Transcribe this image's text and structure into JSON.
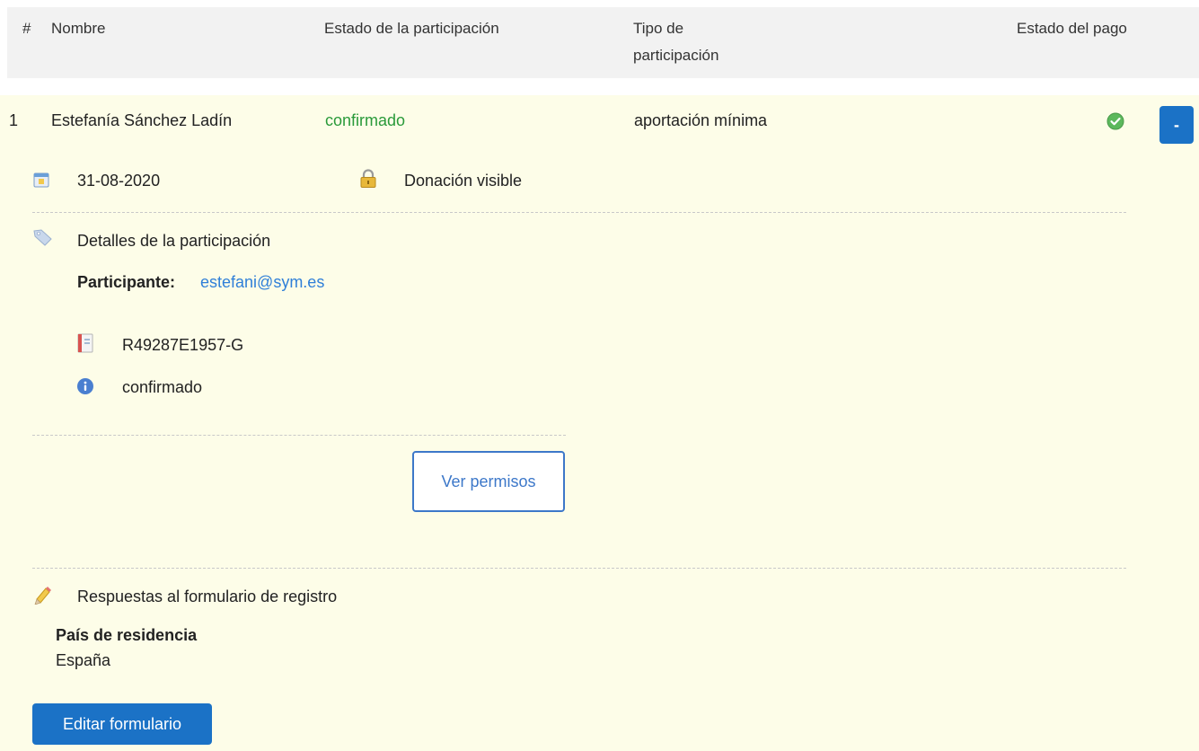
{
  "table": {
    "columns": {
      "index": "#",
      "name": "Nombre",
      "participation_status": "Estado de la participación",
      "participation_type_line1": "Tipo de",
      "participation_type_line2": "participación",
      "payment_status": "Estado del pago"
    },
    "row": {
      "index": "1",
      "name": "Estefanía Sánchez Ladín",
      "participation_status": "confirmado",
      "participation_type": "aportación mínima",
      "payment_status_icon": "check-circle-icon",
      "toggle_label": "-"
    }
  },
  "detail": {
    "date": "31-08-2020",
    "date_icon": "calendar-icon",
    "visibility": "Donación visible",
    "visibility_icon": "lock-icon",
    "section_title": "Detalles de la participación",
    "section_icon": "tag-icon",
    "participant_label": "Participante:",
    "participant_email": "estefani@sym.es",
    "reference": "R49287E1957-G",
    "reference_icon": "book-icon",
    "status": "confirmado",
    "status_icon": "info-icon",
    "permissions_button": "Ver permisos",
    "form_section_title": "Respuestas al formulario de registro",
    "form_section_icon": "pencil-icon",
    "form_field_label": "País de residencia",
    "form_field_value": "España",
    "edit_form_button": "Editar formulario"
  },
  "colors": {
    "accent": "#1b72c6",
    "confirmed": "#2a9a3a",
    "detail_background": "#fdfde8",
    "link": "#2f7fd8"
  }
}
